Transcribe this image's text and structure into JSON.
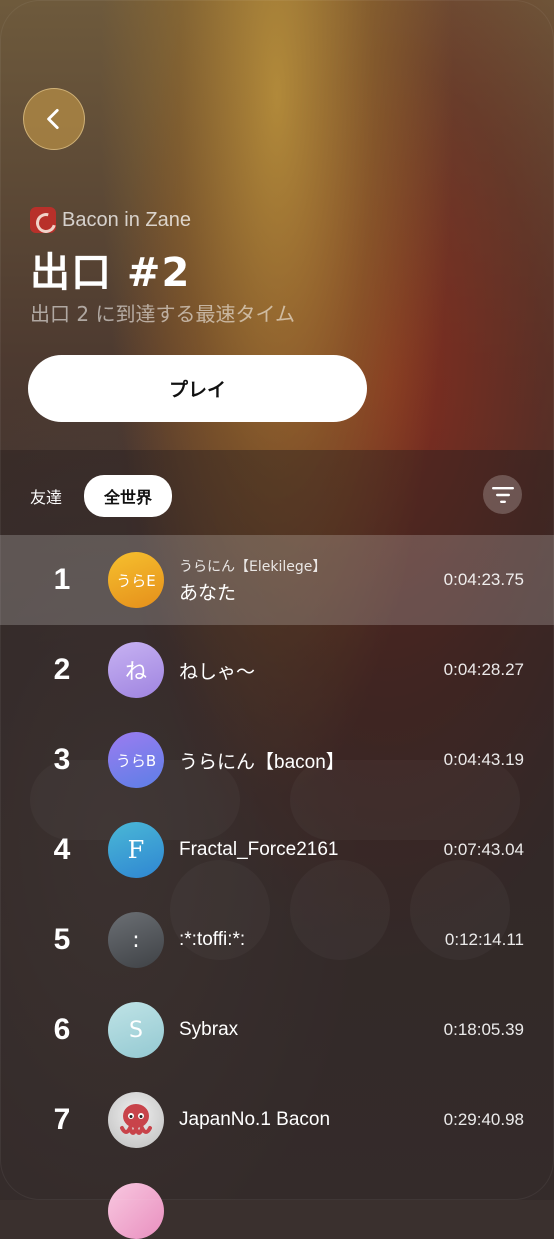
{
  "header": {
    "game_name": "Bacon in Zane",
    "title": "出口 #2",
    "subtitle": "出口 2 に到達する最速タイム",
    "play_label": "プレイ"
  },
  "tabs": [
    {
      "label": "友達",
      "active": false
    },
    {
      "label": "全世界",
      "active": true
    }
  ],
  "icons": {
    "back": "chevron-left-icon",
    "filter": "filter-icon",
    "game": "game-app-icon"
  },
  "leaderboard": [
    {
      "rank": "1",
      "avatar_text": "うらE",
      "subname": "うらにん【Elekilege】",
      "name": "あなた",
      "time": "0:04:23.75",
      "is_me": true,
      "avatar_color": "#f1a323"
    },
    {
      "rank": "2",
      "avatar_text": "ね",
      "subname": "",
      "name": "ねしゃ〜",
      "time": "0:04:28.27",
      "is_me": false,
      "avatar_color": "#b69be8"
    },
    {
      "rank": "3",
      "avatar_text": "うらB",
      "subname": "",
      "name": "うらにん【bacon】",
      "time": "0:04:43.19",
      "is_me": false,
      "avatar_color": "#8a7bea"
    },
    {
      "rank": "4",
      "avatar_text": "F",
      "subname": "",
      "name": "Fractal_Force2161",
      "time": "0:07:43.04",
      "is_me": false,
      "avatar_color": "#3ba9d9"
    },
    {
      "rank": "5",
      "avatar_text": ":",
      "subname": "",
      "name": ":*:toffi:*:",
      "time": "0:12:14.11",
      "is_me": false,
      "avatar_color": "#55595e"
    },
    {
      "rank": "6",
      "avatar_text": "S",
      "subname": "",
      "name": "Sybrax",
      "time": "0:18:05.39",
      "is_me": false,
      "avatar_color": "#a9d6dc"
    },
    {
      "rank": "7",
      "avatar_text": "",
      "subname": "",
      "name": "JapanNo.1 Bacon",
      "time": "0:29:40.98",
      "is_me": false,
      "avatar_color": "#d9d9d9"
    }
  ]
}
